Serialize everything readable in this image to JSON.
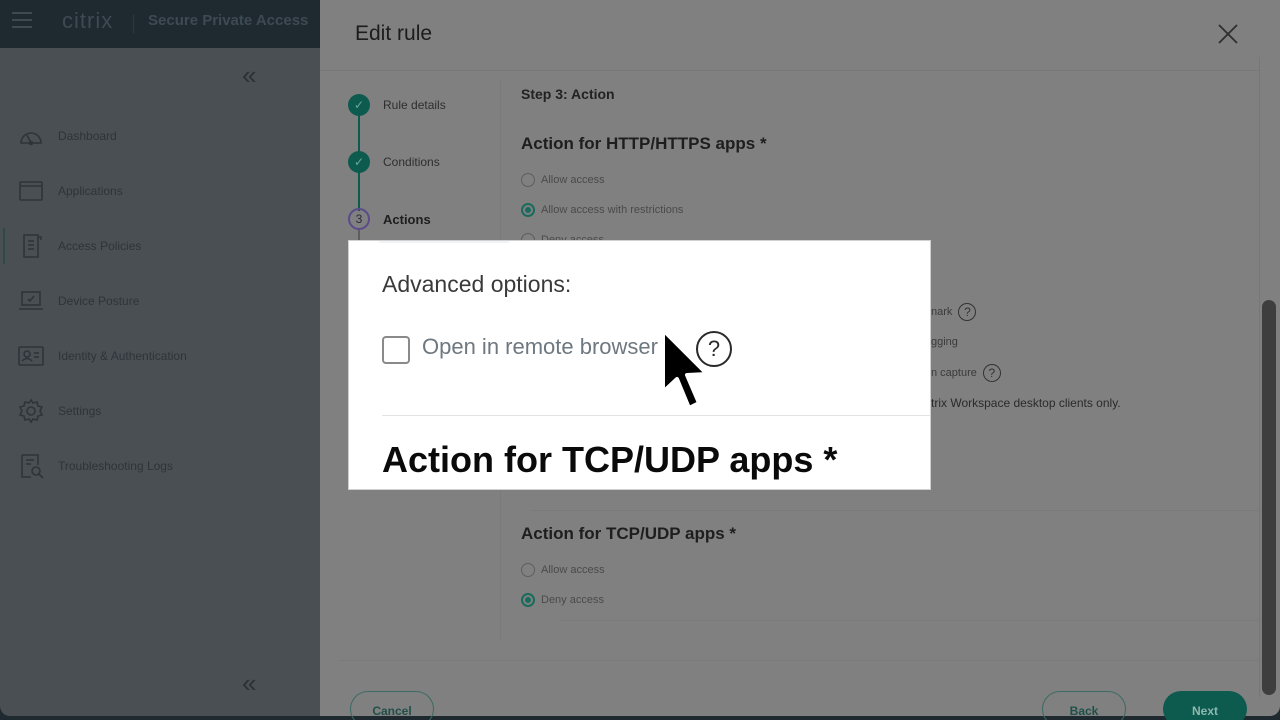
{
  "app": {
    "brand": "citrix",
    "product": "Secure Private Access"
  },
  "sidebar": {
    "items": [
      {
        "label": "Dashboard",
        "icon": "dashboard-gauge-icon"
      },
      {
        "label": "Applications",
        "icon": "applications-window-icon"
      },
      {
        "label": "Access Policies",
        "icon": "access-policies-document-icon",
        "active": true
      },
      {
        "label": "Device Posture",
        "icon": "device-posture-laptop-icon"
      },
      {
        "label": "Identity & Authentication",
        "icon": "identity-card-icon"
      },
      {
        "label": "Settings",
        "icon": "settings-gear-icon"
      },
      {
        "label": "Troubleshooting Logs",
        "icon": "troubleshooting-logs-search-icon"
      }
    ],
    "collapse_glyph": "«"
  },
  "modal": {
    "title": "Edit rule",
    "close_glyph": "✕",
    "stepper": [
      {
        "label": "Rule details",
        "state": "done",
        "marker": "✓"
      },
      {
        "label": "Conditions",
        "state": "done",
        "marker": "✓"
      },
      {
        "label": "Actions",
        "state": "current",
        "marker": "3"
      }
    ],
    "step_heading": "Step 3: Action",
    "http_section": {
      "title": "Action for HTTP/HTTPS apps *",
      "options": [
        {
          "label": "Allow access",
          "checked": false
        },
        {
          "label": "Allow access with restrictions",
          "checked": true
        },
        {
          "label": "Deny access",
          "checked": false
        }
      ]
    },
    "background_partial_text": {
      "watermark": "nark",
      "logging": "gging",
      "capture": "n capture",
      "note": "trix Workspace desktop clients only."
    },
    "tcp_section": {
      "title": "Action for TCP/UDP apps *",
      "options": [
        {
          "label": "Allow access",
          "checked": false
        },
        {
          "label": "Deny access",
          "checked": true
        }
      ]
    },
    "buttons": {
      "cancel": "Cancel",
      "back": "Back",
      "next": "Next"
    }
  },
  "callout": {
    "advanced_label": "Advanced options:",
    "checkbox_label": "Open in remote browser",
    "checkbox_checked": false,
    "help_glyph": "?",
    "tcp_title": "Action for TCP/UDP apps *"
  },
  "colors": {
    "accent": "#0d5a4e",
    "step_current": "#5b4a8a",
    "overlay": "#808080"
  }
}
